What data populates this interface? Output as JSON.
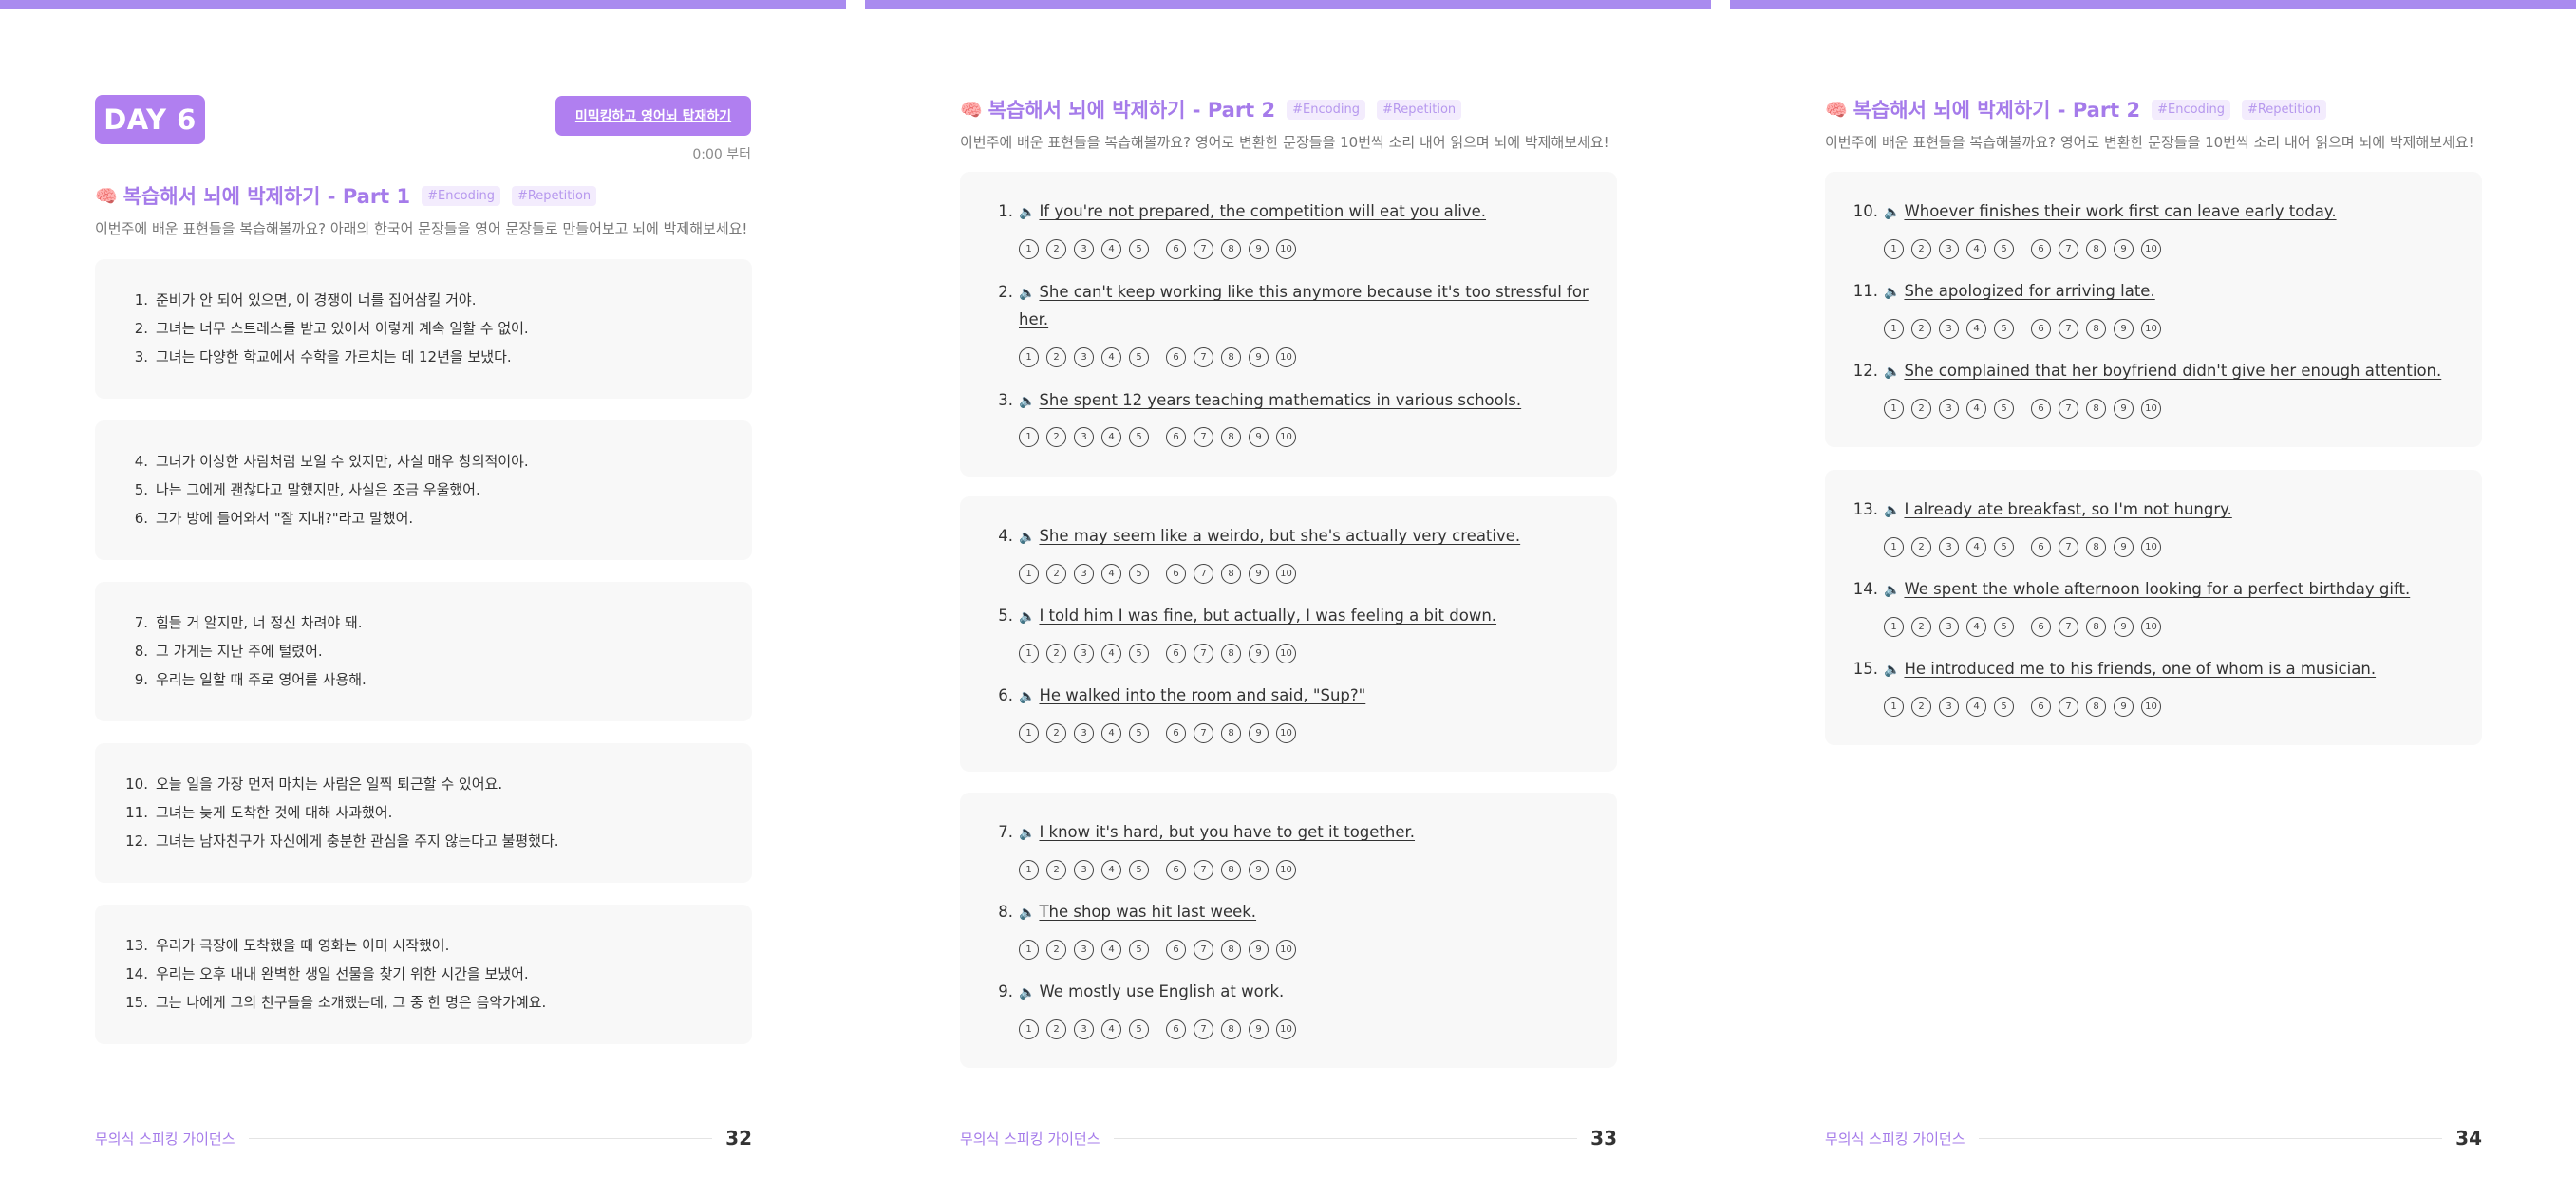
{
  "circle_labels": [
    "1",
    "2",
    "3",
    "4",
    "5",
    "6",
    "7",
    "8",
    "9",
    "10"
  ],
  "pages": [
    {
      "day_badge": "DAY 6",
      "retry_button": "미믹킹하고 영어뇌 탑재하기",
      "time_note": "0:00 부터",
      "section": {
        "title": "복습해서 뇌에 박제하기 - Part 1",
        "tags": [
          "#Encoding",
          "#Repetition"
        ],
        "desc": "이번주에 배운 표현들을 복습해볼까요? 아래의 한국어 문장들을 영어 문장들로 만들어보고 뇌에 박제해보세요!"
      },
      "cards": [
        [
          {
            "num": "1.",
            "text": "준비가 안 되어 있으면, 이 경쟁이 너를 집어삼킬 거야."
          },
          {
            "num": "2.",
            "text": "그녀는  너무 스트레스를 받고 있어서 이렇게 계속 일할 수 없어."
          },
          {
            "num": "3.",
            "text": "그녀는 다양한 학교에서 수학을 가르치는 데 12년을 보냈다."
          }
        ],
        [
          {
            "num": "4.",
            "text": "그녀가 이상한 사람처럼 보일 수 있지만, 사실 매우 창의적이야."
          },
          {
            "num": "5.",
            "text": "나는 그에게 괜찮다고 말했지만, 사실은 조금 우울했어."
          },
          {
            "num": "6.",
            "text": "그가 방에 들어와서 \"잘 지내?\"라고 말했어."
          }
        ],
        [
          {
            "num": "7.",
            "text": "힘들 거 알지만, 너 정신 차려야 돼."
          },
          {
            "num": "8.",
            "text": "그 가게는 지난 주에 털렸어."
          },
          {
            "num": "9.",
            "text": "우리는 일할 때 주로 영어를 사용해."
          }
        ],
        [
          {
            "num": "10.",
            "text": "오늘 일을 가장 먼저 마치는 사람은 일찍 퇴근할 수 있어요."
          },
          {
            "num": "11.",
            "text": "그녀는 늦게 도착한 것에 대해 사과했어."
          },
          {
            "num": "12.",
            "text": "그녀는 남자친구가 자신에게 충분한 관심을 주지 않는다고 불평했다."
          }
        ],
        [
          {
            "num": "13.",
            "text": "우리가 극장에 도착했을 때 영화는 이미 시작했어."
          },
          {
            "num": "14.",
            "text": "우리는 오후 내내 완벽한 생일 선물을 찾기 위한 시간을 보냈어."
          },
          {
            "num": "15.",
            "text": "그는 나에게 그의 친구들을 소개했는데, 그 중 한 명은 음악가예요."
          }
        ]
      ],
      "footer": {
        "brand": "무의식 스피킹 가이던스",
        "page": "32"
      }
    },
    {
      "section": {
        "title": "복습해서 뇌에 박제하기 - Part 2",
        "tags": [
          "#Encoding",
          "#Repetition"
        ],
        "desc": "이번주에 배운 표현들을 복습해볼까요? 영어로 변환한 문장들을 10번씩 소리 내어 읽으며 뇌에 박제해보세요!"
      },
      "cards": [
        [
          {
            "num": "1.",
            "text": "If you're not prepared, the competition will eat you alive."
          },
          {
            "num": "2.",
            "text": "She can't keep working like this anymore because it's too stressful for",
            "cont": "her."
          },
          {
            "num": "3.",
            "text": "She spent 12 years teaching mathematics in various schools."
          }
        ],
        [
          {
            "num": "4.",
            "text": "She may seem like a weirdo, but she's actually very creative."
          },
          {
            "num": "5.",
            "text": "I told him I was fine, but actually, I was feeling a bit down."
          },
          {
            "num": "6.",
            "text": "He walked into the room and said, \"Sup?\""
          }
        ],
        [
          {
            "num": "7.",
            "text": "I know it's hard, but you have to get it together."
          },
          {
            "num": "8.",
            "text": "The shop was hit last week."
          },
          {
            "num": "9.",
            "text": "We mostly use English at work."
          }
        ]
      ],
      "footer": {
        "brand": "무의식 스피킹 가이던스",
        "page": "33"
      }
    },
    {
      "section": {
        "title": "복습해서 뇌에 박제하기 - Part 2",
        "tags": [
          "#Encoding",
          "#Repetition"
        ],
        "desc": "이번주에 배운 표현들을 복습해볼까요? 영어로 변환한 문장들을 10번씩 소리 내어 읽으며 뇌에 박제해보세요!"
      },
      "cards": [
        [
          {
            "num": "10.",
            "text": "Whoever finishes their work first can leave early today."
          },
          {
            "num": "11.",
            "text": "She apologized for arriving late."
          },
          {
            "num": "12.",
            "text": "She complained that her boyfriend didn't give her enough attention."
          }
        ],
        [
          {
            "num": "13.",
            "text": "I already ate breakfast, so I'm not hungry."
          },
          {
            "num": "14.",
            "text": "We spent the whole afternoon looking for a perfect birthday gift."
          },
          {
            "num": "15.",
            "text": "He introduced me to his friends, one of whom is a musician."
          }
        ]
      ],
      "footer": {
        "brand": "무의식 스피킹 가이던스",
        "page": "34"
      }
    }
  ]
}
